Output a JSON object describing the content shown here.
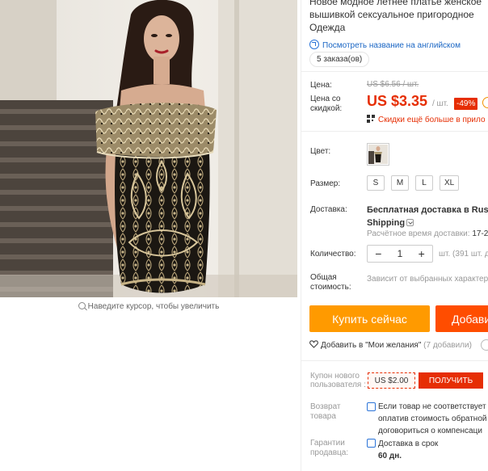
{
  "product": {
    "title_line1": "Новое модное летнее платье женское",
    "title_line2": "вышивкой сексуальное пригородное",
    "title_line3": "Одежда",
    "translate_link": "Посмотреть название на английском",
    "orders": "5 заказа(ов)"
  },
  "gallery": {
    "zoom_hint": "Наведите курсор, чтобы увеличить"
  },
  "pricing": {
    "price_label": "Цена:",
    "old_price": "US $6.56 / шт.",
    "discount_price_label": "Цена со скидкой:",
    "price": "US $3.35",
    "unit": "/ шт.",
    "discount": "-49%",
    "bulk_discount": "Скидки ещё больше в прило"
  },
  "options": {
    "color_label": "Цвет:",
    "size_label": "Размер:",
    "sizes": [
      "S",
      "M",
      "L",
      "XL"
    ]
  },
  "shipping": {
    "label": "Доставка:",
    "main": "Бесплатная доставка в Russian",
    "main2": "Shipping",
    "time_label": "Расчётное время доставки:",
    "time_value": "17-2"
  },
  "quantity": {
    "label": "Количество:",
    "minus": "−",
    "value": "1",
    "plus": "+",
    "note": "шт. (391 шт. д"
  },
  "total": {
    "label": "Общая стоимость:",
    "note": "Зависит от выбранных характер"
  },
  "actions": {
    "buy_now": "Купить сейчас",
    "add_to_cart": "Добави",
    "wishlist": "Добавить в \"Мои желания\"",
    "wishlist_count": "(7 добавили)"
  },
  "coupon": {
    "label": "Купон нового пользователя :",
    "value": "US $2.00",
    "button": "ПОЛУЧИТЬ"
  },
  "returns": {
    "label": "Возврат товара",
    "line1": "Если товар не соответствует",
    "line2": "оплатив стоимость обратной",
    "line3": "договориться о компенсаци"
  },
  "guarantee": {
    "label": "Гарантии продавца:",
    "line1": "Доставка в срок",
    "line2": "60 дн."
  },
  "colors": {
    "accent_red": "#e62e04",
    "buy_orange": "#ff9a00",
    "cart_orange": "#ff4d00",
    "link_blue": "#1a66c4"
  }
}
